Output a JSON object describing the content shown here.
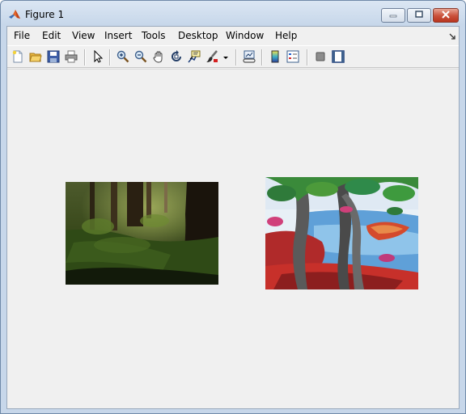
{
  "window": {
    "title": "Figure 1",
    "buttons": {
      "minimize": "minimize-icon",
      "maximize": "maximize-icon",
      "close": "close-icon"
    }
  },
  "menubar": {
    "items": [
      "File",
      "Edit",
      "View",
      "Insert",
      "Tools",
      "Desktop",
      "Window",
      "Help"
    ]
  },
  "toolbar": {
    "icons": [
      "new-figure-icon",
      "open-file-icon",
      "save-icon",
      "print-icon",
      "edit-plot-arrow-icon",
      "zoom-in-icon",
      "zoom-out-icon",
      "pan-hand-icon",
      "rotate-3d-icon",
      "data-cursor-icon",
      "brush-icon",
      "brush-dropdown-icon",
      "link-plot-icon",
      "insert-colorbar-icon",
      "insert-legend-icon",
      "hide-plot-tools-icon",
      "show-plot-tools-icon"
    ]
  },
  "figure": {
    "axes": [
      {
        "content": "forest-image"
      },
      {
        "content": "painting-image"
      }
    ]
  }
}
